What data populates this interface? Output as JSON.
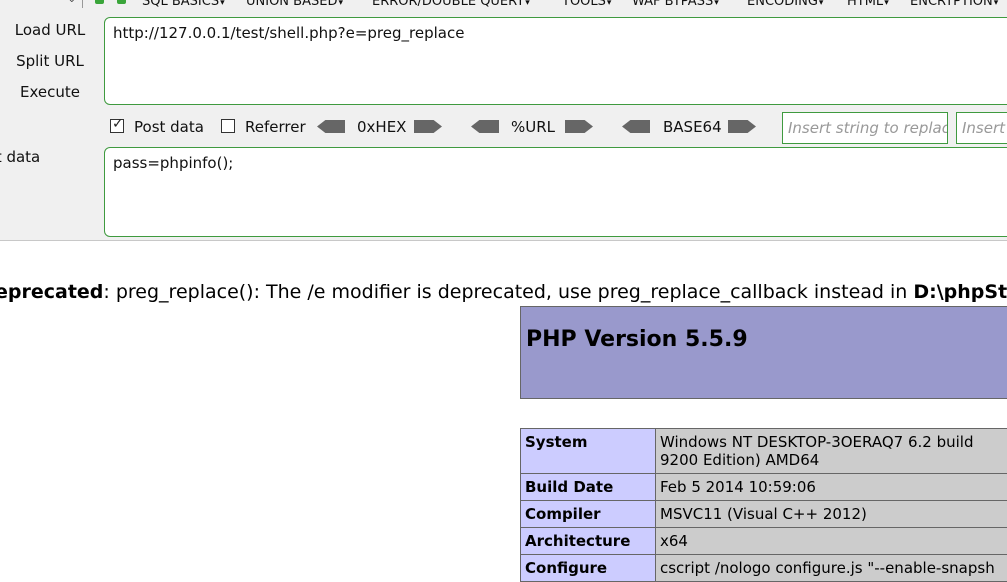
{
  "menubar": {
    "items": [
      "SQL BASICS",
      "UNION BASED",
      "ERROR/DOUBLE QUERY",
      "TOOLS",
      "WAF BYPASS",
      "ENCODING",
      "HTML",
      "ENCRYPTION"
    ]
  },
  "left_buttons": {
    "load": "Load URL",
    "split": "Split URL",
    "execute": "Execute"
  },
  "url": "http://127.0.0.1/test/shell.php?e=preg_replace",
  "options": {
    "post_data_label": "Post data",
    "post_data_checked": true,
    "referrer_label": "Referrer",
    "referrer_checked": false,
    "encoders": [
      "0xHEX",
      "%URL",
      "BASE64"
    ],
    "replace_placeholder": "Insert string to replace",
    "replace_with_placeholder": "Insert"
  },
  "post": {
    "label": "st data",
    "value": "pass=phpinfo();"
  },
  "output": {
    "deprecated_label": "eprecated",
    "deprecated_message": ": preg_replace(): The /e modifier is deprecated, use preg_replace_callback instead in ",
    "deprecated_path": "D:\\phpStu",
    "php_version": "PHP Version 5.5.9",
    "info_rows": [
      {
        "key": "System",
        "value": "Windows NT DESKTOP-3OERAQ7 6.2 build 9200 Edition) AMD64"
      },
      {
        "key": "Build Date",
        "value": "Feb 5 2014 10:59:06"
      },
      {
        "key": "Compiler",
        "value": "MSVC11 (Visual C++ 2012)"
      },
      {
        "key": "Architecture",
        "value": "x64"
      },
      {
        "key": "Configure",
        "value": "cscript /nologo configure.js \"--enable-snapsh"
      }
    ]
  },
  "colors": {
    "accent_border": "#3f9a3f",
    "php_header": "#9999cc",
    "info_key_bg": "#ccccff",
    "info_value_bg": "#cccccc"
  }
}
